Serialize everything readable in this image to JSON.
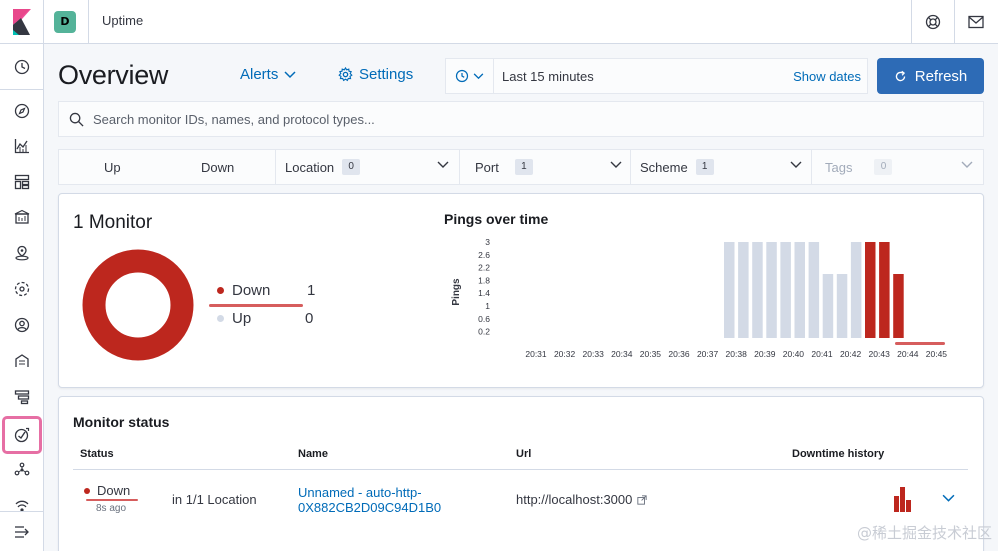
{
  "header": {
    "space_initial": "D",
    "app_title": "Uptime"
  },
  "page": {
    "title": "Overview",
    "alerts_label": "Alerts",
    "settings_label": "Settings"
  },
  "datepicker": {
    "range_text": "Last 15 minutes",
    "show_dates_label": "Show dates"
  },
  "refresh_label": "Refresh",
  "search": {
    "placeholder": "Search monitor IDs, names, and protocol types..."
  },
  "filters": {
    "up_label": "Up",
    "down_label": "Down",
    "location_label": "Location",
    "location_count": "0",
    "port_label": "Port",
    "port_count": "1",
    "scheme_label": "Scheme",
    "scheme_count": "1",
    "tags_label": "Tags",
    "tags_count": "0"
  },
  "snapshot": {
    "title": "1 Monitor",
    "down_label": "Down",
    "down_count": "1",
    "up_label": "Up",
    "up_count": "0"
  },
  "colors": {
    "down": "#bd271e",
    "up": "#d3dae6",
    "accent": "#006bb8",
    "refresh": "#2d6bb6"
  },
  "chart_data": {
    "type": "bar",
    "title": "Pings over time",
    "ylabel": "Pings",
    "xlabel": "",
    "ylim": [
      0,
      3
    ],
    "yticks": [
      "3",
      "2.6",
      "2.2",
      "1.8",
      "1.4",
      "1",
      "0.6",
      "0.2"
    ],
    "categories": [
      "20:31",
      "20:32",
      "20:33",
      "20:34",
      "20:35",
      "20:36",
      "20:37",
      "20:38",
      "20:39",
      "20:40",
      "20:41",
      "20:42",
      "20:43",
      "20:44",
      "20:45"
    ],
    "bars": [
      {
        "t": 20.375,
        "series": "up",
        "value": 3
      },
      {
        "t": 20.375,
        "series": "up",
        "value": 3
      },
      {
        "t": 20.5,
        "series": "up",
        "value": 3
      },
      {
        "t": 20.5,
        "series": "up",
        "value": 3
      },
      {
        "t": 20.625,
        "series": "up",
        "value": 3
      },
      {
        "t": 20.625,
        "series": "up",
        "value": 3
      },
      {
        "t": 20.75,
        "series": "up",
        "value": 3
      },
      {
        "t": 20.75,
        "series": "up",
        "value": 2
      },
      {
        "t": 20.875,
        "series": "up",
        "value": 2
      },
      {
        "t": 20.875,
        "series": "up",
        "value": 3
      },
      {
        "t": 20.875,
        "series": "down",
        "value": 3
      },
      {
        "t": 21.0,
        "series": "down",
        "value": 3
      },
      {
        "t": 21.0,
        "series": "down",
        "value": 2
      }
    ],
    "series_colors": {
      "up": "#d3dae6",
      "down": "#bd271e"
    }
  },
  "monitor_status": {
    "title": "Monitor status",
    "columns": [
      "Status",
      "Name",
      "Url",
      "Downtime history"
    ],
    "rows": [
      {
        "status": "Down",
        "status_time": "8s ago",
        "location": "in 1/1 Location",
        "name_line1": "Unnamed - auto-http-",
        "name_line2": "0X882CB2D09C94D1B0",
        "url": "http://localhost:3000"
      }
    ]
  },
  "watermark": "@稀土掘金技术社区"
}
